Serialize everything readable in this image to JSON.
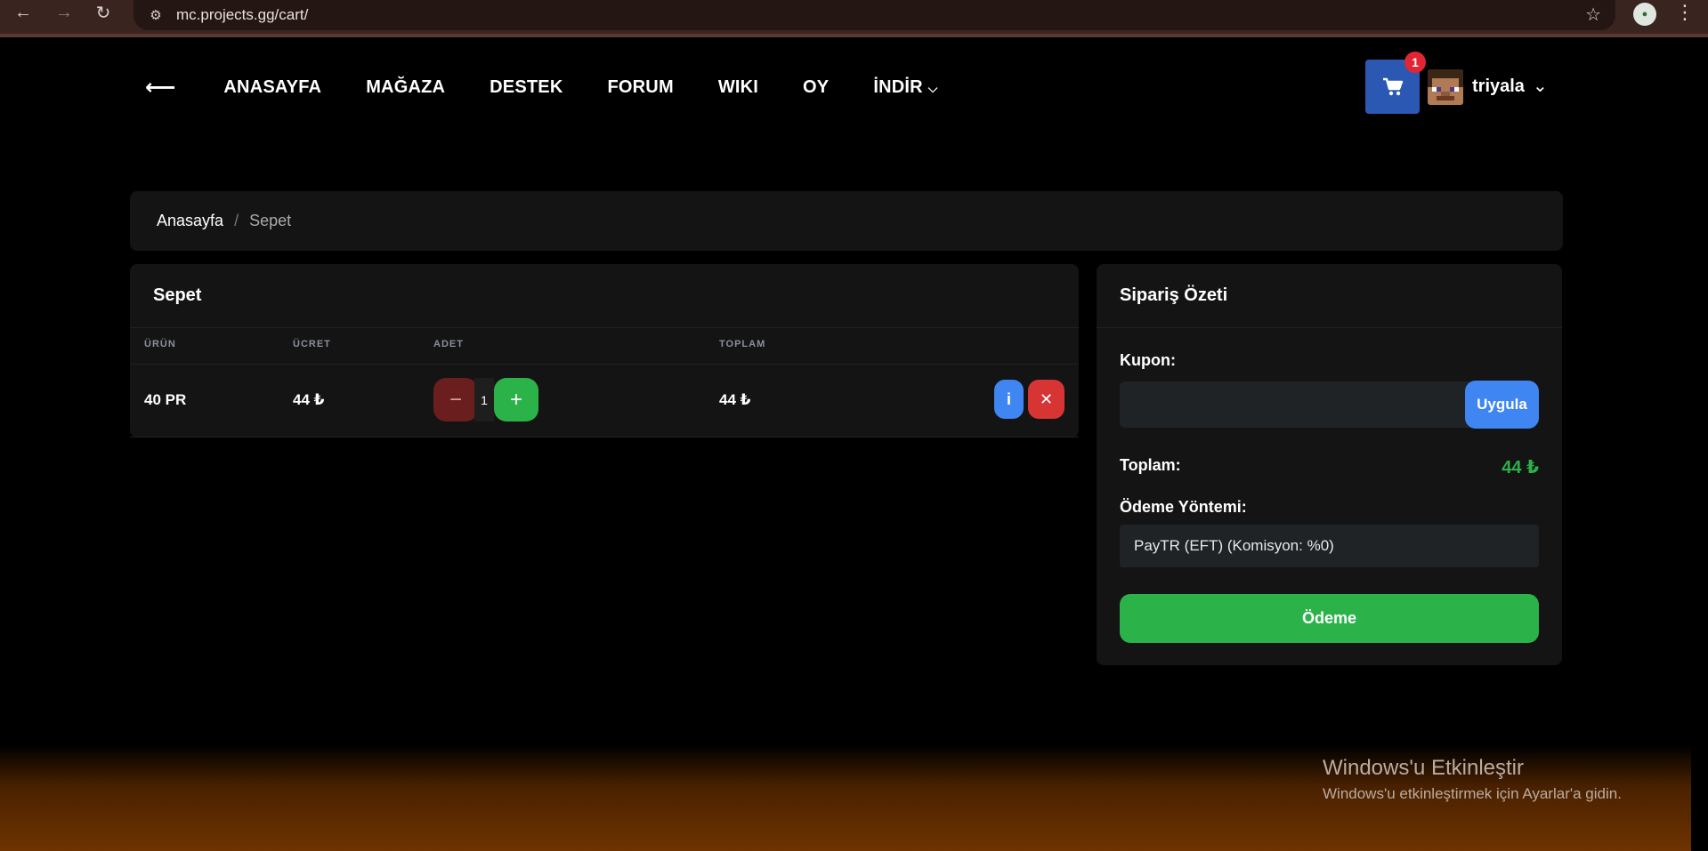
{
  "browser": {
    "url": "mc.projects.gg/cart/"
  },
  "nav": {
    "items": [
      "ANASAYFA",
      "MAĞAZA",
      "DESTEK",
      "FORUM",
      "WIKI",
      "OY",
      "İNDİR"
    ]
  },
  "header": {
    "cart_count": "1",
    "username": "triyala"
  },
  "breadcrumb": {
    "home": "Anasayfa",
    "separator": "/",
    "current": "Sepet"
  },
  "cart": {
    "title": "Sepet",
    "columns": [
      "ÜRÜN",
      "ÜCRET",
      "ADET",
      "TOPLAM"
    ],
    "rows": [
      {
        "product": "40 PR",
        "price": "44 ₺",
        "quantity": "1",
        "total": "44 ₺"
      }
    ]
  },
  "summary": {
    "title": "Sipariş Özeti",
    "coupon_label": "Kupon:",
    "coupon_value": "",
    "apply_label": "Uygula",
    "total_label": "Toplam:",
    "total_value": "44 ₺",
    "payment_label": "Ödeme Yöntemi:",
    "payment_selected": "PayTR (EFT) (Komisyon: %0)",
    "checkout_label": "Ödeme"
  },
  "windows": {
    "title": "Windows'u Etkinleştir",
    "subtitle": "Windows'u etkinleştirmek için Ayarlar'a gidin."
  },
  "colors": {
    "accent_blue": "#3f86f2",
    "cart_blue": "#2b58b3",
    "success_green": "#2bb34a",
    "danger_red": "#d73434"
  }
}
